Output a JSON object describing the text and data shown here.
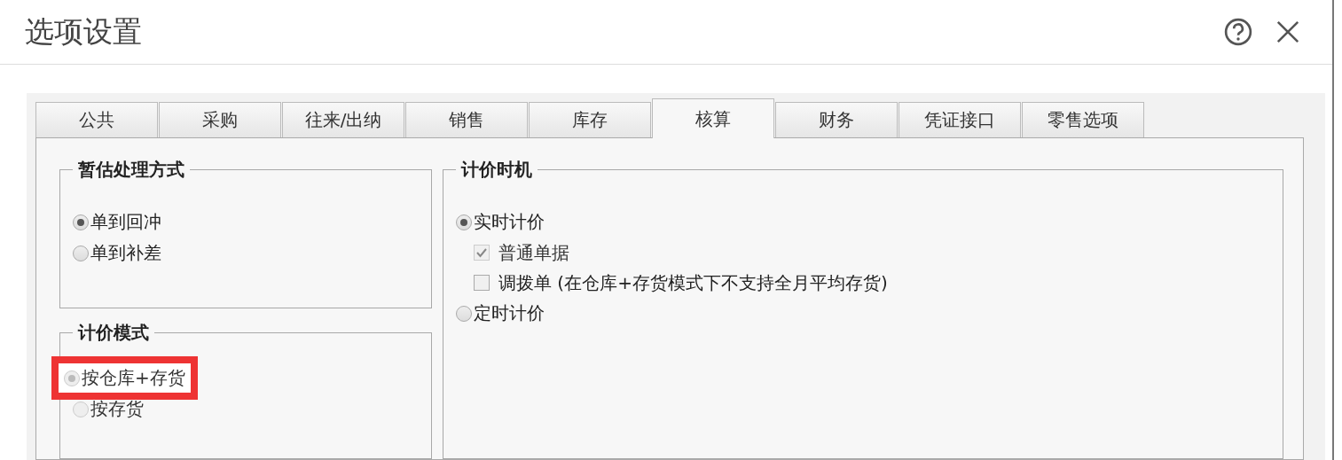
{
  "dialog": {
    "title": "选项设置"
  },
  "tabs": [
    {
      "label": "公共",
      "selected": false
    },
    {
      "label": "采购",
      "selected": false
    },
    {
      "label": "往来/出纳",
      "selected": false
    },
    {
      "label": "销售",
      "selected": false
    },
    {
      "label": "库存",
      "selected": false
    },
    {
      "label": "核算",
      "selected": true
    },
    {
      "label": "财务",
      "selected": false
    },
    {
      "label": "凭证接口",
      "selected": false
    },
    {
      "label": "零售选项",
      "selected": false
    }
  ],
  "left_groups": [
    {
      "title": "暂估处理方式",
      "options": [
        {
          "kind": "radio",
          "label": "单到回冲",
          "selected": true,
          "disabled": false,
          "highlighted": false
        },
        {
          "kind": "radio",
          "label": "单到补差",
          "selected": false,
          "disabled": false,
          "highlighted": false
        }
      ]
    },
    {
      "title": "计价模式",
      "options": [
        {
          "kind": "radio",
          "label": "按仓库+存货",
          "selected": true,
          "disabled": true,
          "highlighted": true
        },
        {
          "kind": "radio",
          "label": "按存货",
          "selected": false,
          "disabled": true,
          "highlighted": false
        }
      ]
    }
  ],
  "right_group": {
    "title": "计价时机",
    "options": [
      {
        "kind": "radio",
        "label": "实时计价",
        "selected": true,
        "disabled": false,
        "highlighted": false,
        "children": [
          {
            "kind": "checkbox",
            "label": "普通单据",
            "checked": true,
            "disabled": true
          },
          {
            "kind": "checkbox",
            "label": "调拨单 (在仓库+存货模式下不支持全月平均存货)",
            "checked": false,
            "disabled": false
          }
        ]
      },
      {
        "kind": "radio",
        "label": "定时计价",
        "selected": false,
        "disabled": false,
        "highlighted": false
      }
    ]
  }
}
